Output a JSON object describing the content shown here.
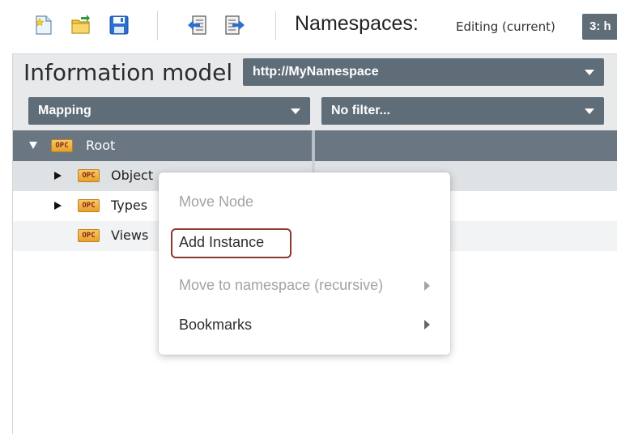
{
  "toolbar": {
    "icons": [
      "new-file-icon",
      "open-file-icon",
      "save-icon",
      "import-icon",
      "export-icon"
    ],
    "namespaces_label": "Namespaces:",
    "editing_label": "Editing (current)",
    "namespace_chip": "3: h"
  },
  "info_model": {
    "title": "Information model",
    "namespace_select": "http://MyNamespace",
    "mapping_select": "Mapping",
    "filter_select": "No filter..."
  },
  "tree": {
    "badge": "OPC",
    "root": "Root",
    "nodes": [
      "Object",
      "Types",
      "Views"
    ]
  },
  "context_menu": {
    "move_node": "Move Node",
    "add_instance": "Add Instance",
    "move_to_namespace": "Move to namespace (recursive)",
    "bookmarks": "Bookmarks"
  },
  "colors": {
    "select_bg": "#5f6d78",
    "tree_header_bg": "#6a7782",
    "highlight_border": "#8a3a2e",
    "disabled_text": "#a3a3a3"
  }
}
